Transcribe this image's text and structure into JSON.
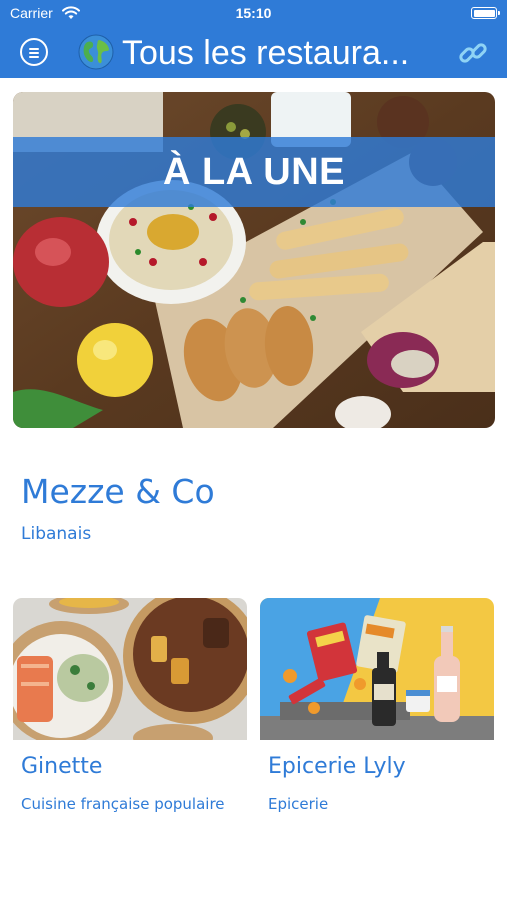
{
  "status_bar": {
    "carrier": "Carrier",
    "time": "15:10"
  },
  "nav_bar": {
    "title": "Tous les restaura...",
    "icons": {
      "menu": "hamburger-circle-icon",
      "globe": "globe-emoji-icon",
      "link": "link-icon"
    }
  },
  "featured": {
    "banner": "À LA UNE",
    "name": "Mezze & Co",
    "category": "Libanais"
  },
  "restaurants": [
    {
      "name": "Ginette",
      "category": "Cuisine française populaire"
    },
    {
      "name": "Epicerie Lyly",
      "category": "Epicerie"
    }
  ],
  "colors": {
    "accent": "#2f7bd7",
    "background": "#ffffff"
  }
}
